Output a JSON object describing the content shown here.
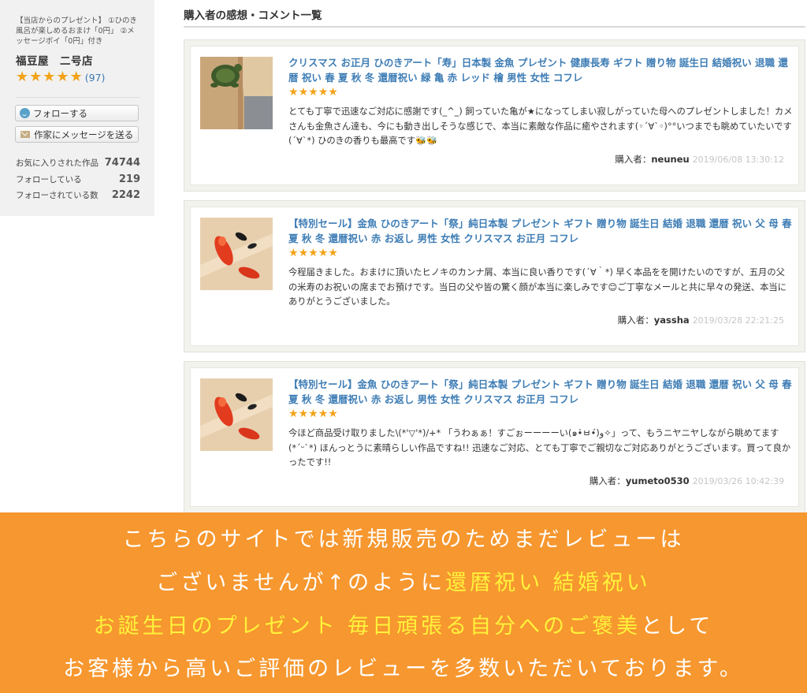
{
  "sidebar": {
    "promo_text": "【当店からのプレゼント】 ①ひのき風呂が楽しめるおまけ「0円」 ②メッセージボイ「0円」付き",
    "shop_name": "福豆屋　二号店",
    "rating_stars": 5,
    "review_count": "(97)",
    "follow_button": "フォローする",
    "message_button": "作家にメッセージを送る",
    "stats": [
      {
        "label": "お気に入りされた作品",
        "value": "74744"
      },
      {
        "label": "フォローしている",
        "value": "219"
      },
      {
        "label": "フォローされている数",
        "value": "2242"
      }
    ]
  },
  "main": {
    "section_title": "購入者の感想・コメント一覧",
    "reviews": [
      {
        "title": "クリスマス お正月 ひのきアート「寿」日本製 金魚 プレゼント 健康長寿 ギフト 贈り物 誕生日 結婚祝い 退職 還暦 祝い 春 夏 秋 冬 還暦祝い 緑 亀 赤 レッド 檜 男性 女性 コフレ",
        "stars": 5,
        "body": "とても丁寧で迅速なご対応に感謝です(_^_) 飼っていた亀が★になってしまい寂しがっていた母へのプレゼントしました！カメさんも金魚さん達も、今にも動き出しそうな感じで、本当に素敵な作品に癒やされます(◦´∀`◦)°°いつまでも眺めていたいです(´∀`*) ひのきの香りも最高です🐝🐝",
        "buyer_label": "購入者：",
        "buyer_name": "neuneu",
        "timestamp": "2019/06/08 13:30:12"
      },
      {
        "title": "【特別セール】金魚 ひのきアート「祭」純日本製 プレゼント ギフト 贈り物 誕生日 結婚 退職 還暦 祝い 父 母 春 夏 秋 冬 還暦祝い 赤 お返し 男性 女性 クリスマス お正月 コフレ",
        "stars": 5,
        "body": "今程届きました。おまけに頂いたヒノキのカンナ屑、本当に良い香りです(´∀｀*) 早く本品をを開けたいのですが、五月の父の米寿のお祝いの席までお預けです。当日の父や皆の驚く顔が本当に楽しみです😊ご丁寧なメールと共に早々の発送、本当にありがとうございました。",
        "buyer_label": "購入者：",
        "buyer_name": "yassha",
        "timestamp": "2019/03/28 22:21:25"
      },
      {
        "title": "【特別セール】金魚 ひのきアート「祭」純日本製 プレゼント ギフト 贈り物 誕生日 結婚 退職 還暦 祝い 父 母 春 夏 秋 冬 還暦祝い 赤 お返し 男性 女性 クリスマス お正月 コフレ",
        "stars": 5,
        "body": "今ほど商品受け取りました\\(*'▽'*)/+* 「うわぁぁ！すごぉーーーーい(๑•̀ㅂ•́)و✧」って、もうニヤニヤしながら眺めてます(*ˊᵕˋ*) ほんっとうに素晴らしい作品ですね!! 迅速なご対応、とても丁寧でご親切なご対応ありがとうございます。買って良かったです!!",
        "buyer_label": "購入者：",
        "buyer_name": "yumeto0530",
        "timestamp": "2019/03/26 10:42:39"
      }
    ]
  },
  "banner": {
    "line1": "こちらのサイトでは新規販売のためまだレビューは",
    "line2a": "ございませんが↑のように",
    "line2b": "還暦祝い 結婚祝い",
    "line3a": "お誕生日のプレゼント 毎日頑張る自分へのご褒美",
    "line3b": "として",
    "line4": "お客様から高いご評価のレビューを多数いただいております。"
  },
  "colors": {
    "link_blue": "#3e7db5",
    "star_orange": "#f2a31a",
    "banner_orange": "#f6972f",
    "highlight_yellow": "#fff23b"
  }
}
